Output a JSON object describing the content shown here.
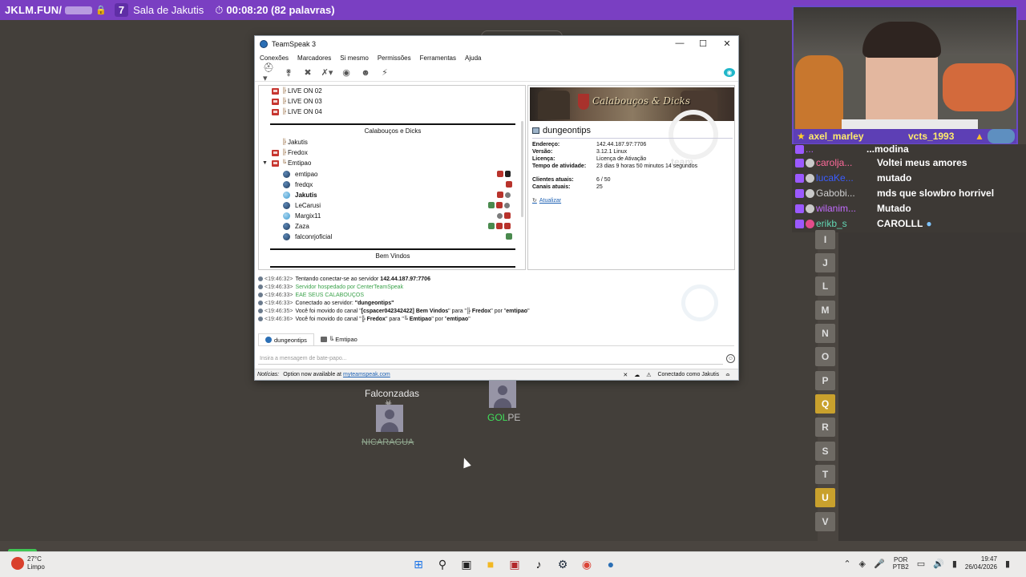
{
  "topbar": {
    "site": "JKLM.FUN/",
    "room_number": "7",
    "room_name": "Sala de Jakutis",
    "timer": "00:08:20 (82 palavras)"
  },
  "teamspeak": {
    "window_title": "TeamSpeak 3",
    "menu": [
      "Conexões",
      "Marcadores",
      "Si mesmo",
      "Permissões",
      "Ferramentas",
      "Ajuda"
    ],
    "tree": {
      "live_channels": [
        "LIVE ON 02",
        "LIVE ON 03",
        "LIVE ON 04"
      ],
      "spacer1": "Calabouços e Dicks",
      "channels": [
        "Jakutis",
        "Fredox",
        "Emtipao"
      ],
      "clients": [
        "emtipao",
        "fredqx",
        "Jakutis",
        "LeCarusi",
        "Margix11",
        "Zaza",
        "falconrjoficial"
      ],
      "spacer2": "Bem Vindos"
    },
    "server": {
      "banner_text": "Calabouços & Dicks",
      "name": "dungeontips",
      "rows": [
        {
          "k": "Endereço:",
          "v": "142.44.187.97:7706"
        },
        {
          "k": "Versão:",
          "v": "3.12.1 Linux"
        },
        {
          "k": "Licença:",
          "v": "Licença de Ativação"
        },
        {
          "k": "Tempo de atividade:",
          "v": "23 dias 9 horas 50 minutos 14 segundos"
        },
        {
          "k": "Clientes atuais:",
          "v": "6 / 50"
        },
        {
          "k": "Canais atuais:",
          "v": "25"
        }
      ],
      "refresh": "Atualizar",
      "watermark": "team"
    },
    "log": {
      "l1_time": "<19:46:32>",
      "l1_text": "Tentando conectar-se ao servidor",
      "l1_bold": "142.44.187.97:7706",
      "l2_time": "<19:46:33>",
      "l2_text": "Servidor hospedado por CenterTeamSpeak",
      "l3_time": "<19:46:33>",
      "l3_text": "EAE SEUS CALABOUÇOS",
      "l4_time": "<19:46:33>",
      "l4_text": "Conectado ao servidor:",
      "l4_bold": "\"dungeontips\"",
      "l5_time": "<19:46:35>",
      "l5_a": "Você foi movido do canal \"",
      "l5_b": "[cspacer042342422] Bem Vindos",
      "l5_c": "\" para \"",
      "l5_d": "╠ Fredox",
      "l5_e": "\" por \"",
      "l5_f": "emtipao",
      "l5_g": "\"",
      "l6_time": "<19:46:36>",
      "l6_a": "Você foi movido do canal \"",
      "l6_b": "╠ Fredox",
      "l6_c": "\" para \"",
      "l6_d": "╚ Emtipao",
      "l6_e": "\" por \"",
      "l6_f": "emtipao",
      "l6_g": "\""
    },
    "tabs": [
      "dungeontips",
      "╚ Emtipao"
    ],
    "chat_placeholder": "Insira a mensagem de bate-papo...",
    "status": {
      "news_label": "Notícias:",
      "news_text": "Option now available at",
      "news_link": "myteamspeak.com",
      "connected": "Conectado como Jakutis"
    }
  },
  "webcam": {
    "name1": "axel_marley",
    "name2": "vcts_1993"
  },
  "chat": [
    {
      "user": "...",
      "msg": "...modina",
      "color": "#b061ff"
    },
    {
      "user": "carolja...",
      "msg": "Voltei meus amores",
      "color": "#ff6a9a"
    },
    {
      "user": "lucaKe...",
      "msg": "mutado",
      "color": "#3a5cff"
    },
    {
      "user": "Gabobi...",
      "msg": "mds que slowbro horrivel",
      "color": "#cfcfcf"
    },
    {
      "user": "wilanim...",
      "msg": "Mutado",
      "color": "#c36bff"
    },
    {
      "user": "erikb_s",
      "msg": "CAROLLL",
      "color": "#62d6b3"
    }
  ],
  "letters": [
    {
      "l": "I",
      "hl": false
    },
    {
      "l": "J",
      "hl": false
    },
    {
      "l": "L",
      "hl": false
    },
    {
      "l": "M",
      "hl": false
    },
    {
      "l": "N",
      "hl": false
    },
    {
      "l": "O",
      "hl": false
    },
    {
      "l": "P",
      "hl": false
    },
    {
      "l": "Q",
      "hl": true
    },
    {
      "l": "R",
      "hl": false
    },
    {
      "l": "S",
      "hl": false
    },
    {
      "l": "T",
      "hl": false
    },
    {
      "l": "U",
      "hl": true
    },
    {
      "l": "V",
      "hl": false
    }
  ],
  "game": {
    "player1": "Falconzadas",
    "player1_country": "NICARAGUA",
    "player2_a": "GOL",
    "player2_b": "PE"
  },
  "taskbar": {
    "temp": "27°C",
    "weather": "Limpo",
    "lang1": "POR",
    "lang2": "PTB2",
    "time": "19:47",
    "date": "26/04/2026"
  }
}
